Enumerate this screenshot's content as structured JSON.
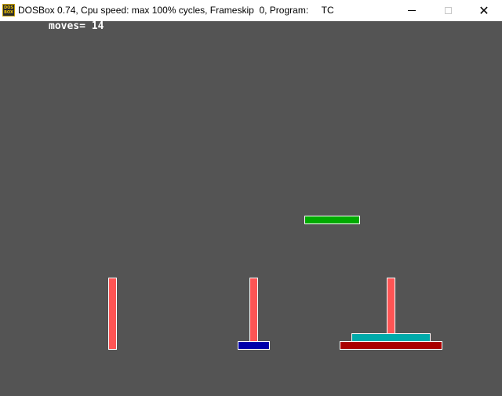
{
  "window": {
    "title": "DOSBox 0.74, Cpu speed: max 100% cycles, Frameskip  0, Program:     TC",
    "icon": "dosbox-icon",
    "icon_text_line1": "DOS",
    "icon_text_line2": "BOX"
  },
  "controls": {
    "minimize": "minimize-icon",
    "maximize": "maximize-icon",
    "close_glyph": "✕"
  },
  "game": {
    "moves_label": "moves=",
    "moves_value": "14",
    "peg_color": "#fe5454",
    "pegs": [
      "left",
      "middle",
      "right"
    ],
    "disks": [
      {
        "name": "green",
        "color": "#00aa00",
        "state": "lifted"
      },
      {
        "name": "blue",
        "color": "#0000aa",
        "peg": "middle"
      },
      {
        "name": "cyan",
        "color": "#00aaaa",
        "peg": "right"
      },
      {
        "name": "red",
        "color": "#aa0000",
        "peg": "right"
      }
    ]
  }
}
